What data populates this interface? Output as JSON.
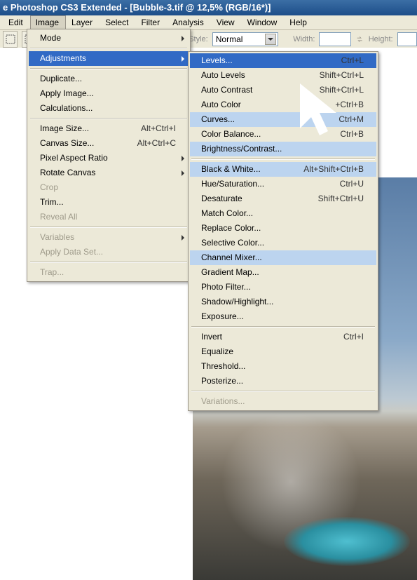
{
  "title": "e Photoshop CS3 Extended - [Bubble-3.tif @ 12,5% (RGB/16*)]",
  "menubar": {
    "edit": "Edit",
    "image": "Image",
    "layer": "Layer",
    "select": "Select",
    "filter": "Filter",
    "analysis": "Analysis",
    "view": "View",
    "window": "Window",
    "help": "Help"
  },
  "toolbar": {
    "style_label": "Style:",
    "style_value": "Normal",
    "width_label": "Width:",
    "height_label": "Height:"
  },
  "imageMenu": [
    {
      "label": "Mode",
      "submenu": true
    },
    {
      "sep": true
    },
    {
      "label": "Adjustments",
      "submenu": true,
      "activeBlue": true
    },
    {
      "sep": true
    },
    {
      "label": "Duplicate..."
    },
    {
      "label": "Apply Image..."
    },
    {
      "label": "Calculations..."
    },
    {
      "sep": true
    },
    {
      "label": "Image Size...",
      "shortcut": "Alt+Ctrl+I"
    },
    {
      "label": "Canvas Size...",
      "shortcut": "Alt+Ctrl+C"
    },
    {
      "label": "Pixel Aspect Ratio",
      "submenu": true
    },
    {
      "label": "Rotate Canvas",
      "submenu": true
    },
    {
      "label": "Crop",
      "disabled": true
    },
    {
      "label": "Trim..."
    },
    {
      "label": "Reveal All",
      "disabled": true
    },
    {
      "sep": true
    },
    {
      "label": "Variables",
      "submenu": true,
      "disabled": true
    },
    {
      "label": "Apply Data Set...",
      "disabled": true
    },
    {
      "sep": true
    },
    {
      "label": "Trap...",
      "disabled": true
    }
  ],
  "adjustmentsMenu": [
    {
      "label": "Levels...",
      "shortcut": "Ctrl+L",
      "activeBlue": true
    },
    {
      "label": "Auto Levels",
      "shortcut": "Shift+Ctrl+L"
    },
    {
      "label": "Auto Contrast",
      "shortcut": "Shift+Ctrl+L"
    },
    {
      "label": "Auto Color",
      "shortcut": "+Ctrl+B"
    },
    {
      "label": "Curves...",
      "shortcut": "Ctrl+M",
      "hover": true
    },
    {
      "label": "Color Balance...",
      "shortcut": "Ctrl+B"
    },
    {
      "label": "Brightness/Contrast...",
      "hover": true
    },
    {
      "sep": true
    },
    {
      "label": "Black & White...",
      "shortcut": "Alt+Shift+Ctrl+B",
      "hover": true
    },
    {
      "label": "Hue/Saturation...",
      "shortcut": "Ctrl+U"
    },
    {
      "label": "Desaturate",
      "shortcut": "Shift+Ctrl+U"
    },
    {
      "label": "Match Color..."
    },
    {
      "label": "Replace Color..."
    },
    {
      "label": "Selective Color..."
    },
    {
      "label": "Channel Mixer...",
      "hover": true
    },
    {
      "label": "Gradient Map..."
    },
    {
      "label": "Photo Filter..."
    },
    {
      "label": "Shadow/Highlight..."
    },
    {
      "label": "Exposure..."
    },
    {
      "sep": true
    },
    {
      "label": "Invert",
      "shortcut": "Ctrl+I"
    },
    {
      "label": "Equalize"
    },
    {
      "label": "Threshold..."
    },
    {
      "label": "Posterize..."
    },
    {
      "sep": true
    },
    {
      "label": "Variations...",
      "disabled": true
    }
  ]
}
